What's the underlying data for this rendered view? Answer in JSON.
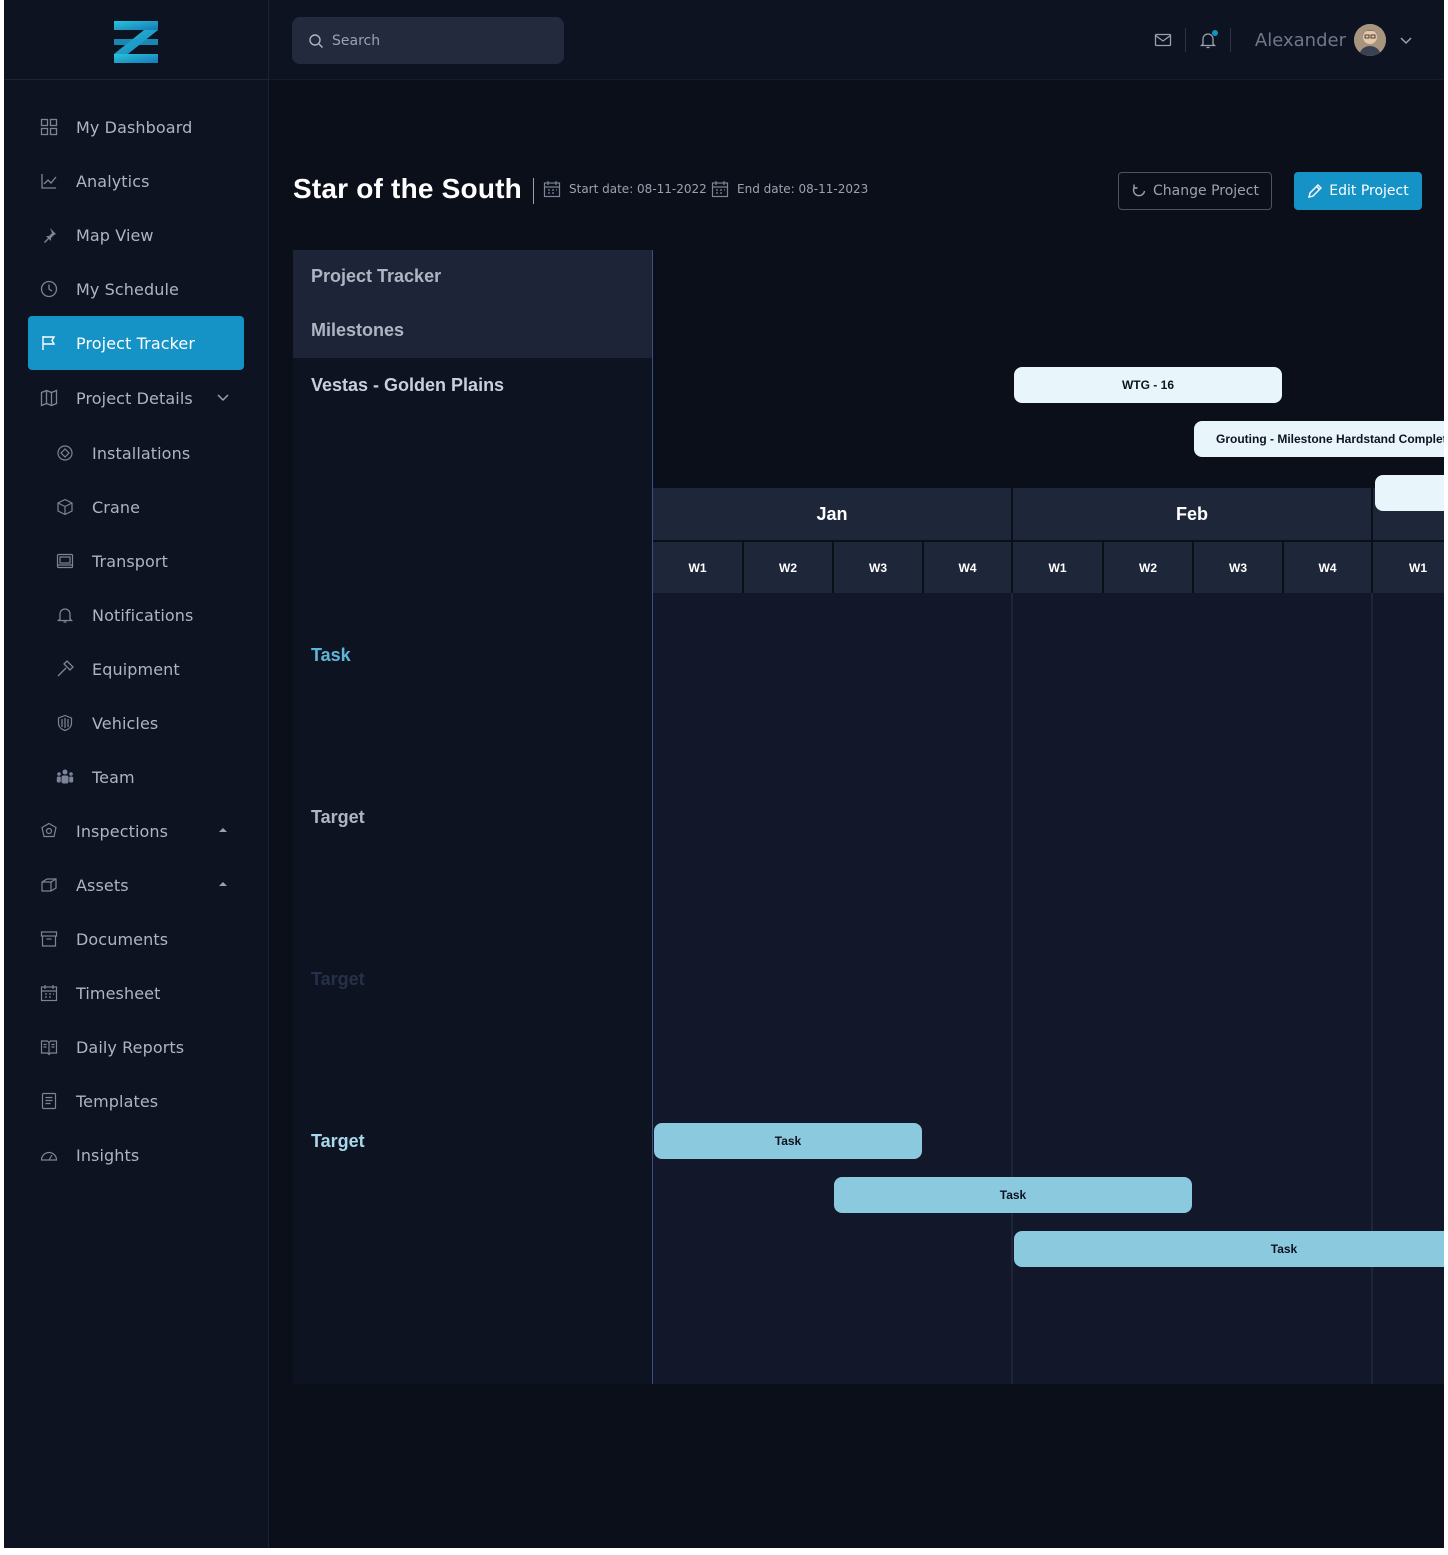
{
  "topbar": {
    "search_placeholder": "Search",
    "user_name": "Alexander"
  },
  "sidebar": {
    "items": [
      {
        "label": "My Dashboard",
        "icon": "grid-icon"
      },
      {
        "label": "Analytics",
        "icon": "chart-line-icon"
      },
      {
        "label": "Map View",
        "icon": "pin-icon"
      },
      {
        "label": "My Schedule",
        "icon": "clock-icon"
      },
      {
        "label": "Project Tracker",
        "icon": "flag-icon",
        "active": true
      },
      {
        "label": "Project Details",
        "icon": "map-icon",
        "expanded": true
      },
      {
        "label": "Installations",
        "icon": "installations-icon"
      },
      {
        "label": "Crane",
        "icon": "cube-icon"
      },
      {
        "label": "Transport",
        "icon": "transport-icon"
      },
      {
        "label": "Notifications",
        "icon": "bell-icon"
      },
      {
        "label": "Equipment",
        "icon": "hammer-icon"
      },
      {
        "label": "Vehicles",
        "icon": "shield-icon"
      },
      {
        "label": "Team",
        "icon": "team-icon"
      },
      {
        "label": "Inspections",
        "icon": "inspections-icon"
      },
      {
        "label": "Assets",
        "icon": "assets-icon"
      },
      {
        "label": "Documents",
        "icon": "archive-icon"
      },
      {
        "label": "Timesheet",
        "icon": "calendar-icon"
      },
      {
        "label": "Daily Reports",
        "icon": "book-icon"
      },
      {
        "label": "Templates",
        "icon": "document-icon"
      },
      {
        "label": "Insights",
        "icon": "gauge-icon"
      }
    ]
  },
  "page": {
    "title": "Star of the South",
    "start_date": "Start date: 08-11-2022",
    "end_date": "End date: 08-11-2023",
    "change_project_label": "Change Project",
    "edit_project_label": "Edit Project"
  },
  "tracker": {
    "header_labels": [
      "Project Tracker",
      "Milestones"
    ],
    "rows": [
      "Vestas - Golden Plains",
      "Task",
      "Target",
      "Target",
      "Target"
    ],
    "months": [
      "Jan",
      "Feb",
      ""
    ],
    "weeks": [
      "W1",
      "W2",
      "W3",
      "W4",
      "W1",
      "W2",
      "W3",
      "W4",
      "W1"
    ],
    "milestones": [
      {
        "label": "WTG - 16"
      },
      {
        "label": "Grouting - Milestone Hardstand Complete"
      },
      {
        "label": ""
      }
    ],
    "tasks": [
      {
        "label": "Task"
      },
      {
        "label": "Task"
      },
      {
        "label": "Task"
      }
    ]
  },
  "colors": {
    "accent": "#1593c6",
    "background": "#0b0f1a",
    "sidebar": "#0e1321",
    "task_bar": "#8bc9de",
    "milestone_bar": "#e8f6fb"
  }
}
